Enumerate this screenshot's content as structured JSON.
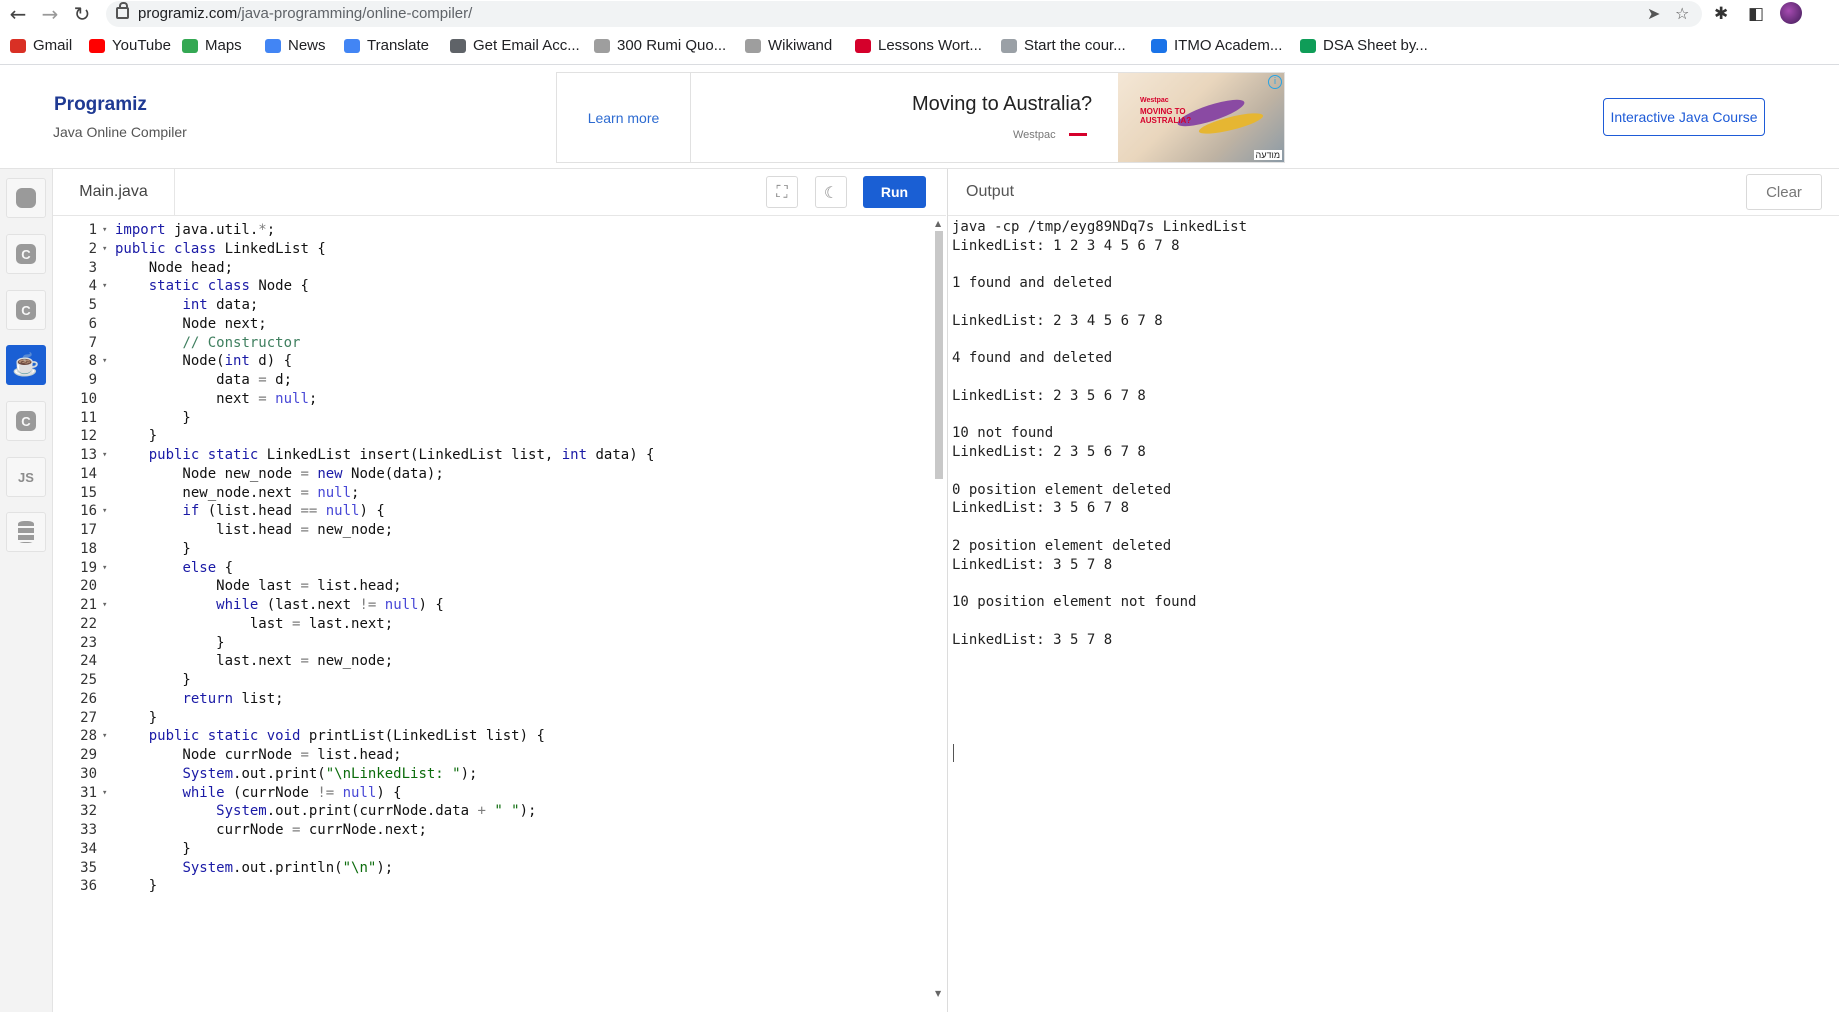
{
  "browser": {
    "url_host": "programiz.com",
    "url_path": "/java-programming/online-compiler/",
    "bookmarks": [
      {
        "label": "Gmail",
        "icon": "gmail-icon",
        "color": "#d93025"
      },
      {
        "label": "YouTube",
        "icon": "youtube-icon",
        "color": "#ff0000"
      },
      {
        "label": "Maps",
        "icon": "maps-icon",
        "color": "#34a853"
      },
      {
        "label": "News",
        "icon": "news-icon",
        "color": "#4285f4"
      },
      {
        "label": "Translate",
        "icon": "translate-icon",
        "color": "#4285f4"
      },
      {
        "label": "Get Email Acc...",
        "icon": "globe-icon",
        "color": "#5f6368"
      },
      {
        "label": "300 Rumi Quo...",
        "icon": "w-icon",
        "color": "#9e9e9e"
      },
      {
        "label": "Wikiwand",
        "icon": "wikiwand-icon",
        "color": "#9e9e9e"
      },
      {
        "label": "Lessons Wort...",
        "icon": "lessons-icon",
        "color": "#d5002b"
      },
      {
        "label": "Start the cour...",
        "icon": "course-icon",
        "color": "#9aa0a6"
      },
      {
        "label": "ITMO Academ...",
        "icon": "itmo-icon",
        "color": "#1a73e8"
      },
      {
        "label": "DSA Sheet by...",
        "icon": "sheets-icon",
        "color": "#0f9d58"
      }
    ]
  },
  "header": {
    "logo": "Programiz",
    "subtitle": "Java Online Compiler",
    "ad": {
      "learn_more": "Learn more",
      "headline": "Moving to Australia?",
      "brand": "Westpac",
      "image_brand": "Westpac",
      "image_text": "MOVING TO AUSTRALIA?",
      "image_label": "מודעה"
    },
    "course_button": "Interactive Java Course"
  },
  "sidebar": {
    "languages": [
      {
        "name": "python",
        "label": "",
        "icon": "python-icon"
      },
      {
        "name": "c",
        "label": "C",
        "icon": "c-icon"
      },
      {
        "name": "cpp",
        "label": "C",
        "icon": "cpp-icon"
      },
      {
        "name": "java",
        "label": "☕",
        "icon": "java-icon",
        "active": true
      },
      {
        "name": "csharp",
        "label": "C",
        "icon": "csharp-icon"
      },
      {
        "name": "js",
        "label": "JS",
        "icon": "js-icon"
      },
      {
        "name": "sql",
        "label": "",
        "icon": "database-icon"
      }
    ]
  },
  "editor": {
    "file_name": "Main.java",
    "run_label": "Run",
    "lines": [
      "import java.util.*;",
      "public class LinkedList {",
      "    Node head;",
      "    static class Node {",
      "        int data;",
      "        Node next;",
      "        // Constructor",
      "        Node(int d) {",
      "            data = d;",
      "            next = null;",
      "        }",
      "    }",
      "    public static LinkedList insert(LinkedList list, int data) {",
      "        Node new_node = new Node(data);",
      "        new_node.next = null;",
      "        if (list.head == null) {",
      "            list.head = new_node;",
      "        }",
      "        else {",
      "            Node last = list.head;",
      "            while (last.next != null) {",
      "                last = last.next;",
      "            }",
      "            last.next = new_node;",
      "        }",
      "        return list;",
      "    }",
      "    public static void printList(LinkedList list) {",
      "        Node currNode = list.head;",
      "        System.out.print(\"\\nLinkedList: \");",
      "        while (currNode != null) {",
      "            System.out.print(currNode.data + \" \");",
      "            currNode = currNode.next;",
      "        }",
      "        System.out.println(\"\\n\");",
      "    }"
    ],
    "fold_lines": [
      1,
      2,
      4,
      8,
      13,
      16,
      19,
      21,
      28,
      31
    ]
  },
  "output": {
    "title": "Output",
    "clear_label": "Clear",
    "lines": [
      "java -cp /tmp/eyg89NDq7s LinkedList",
      "LinkedList: 1 2 3 4 5 6 7 8",
      "",
      "1 found and deleted",
      "",
      "LinkedList: 2 3 4 5 6 7 8",
      "",
      "4 found and deleted",
      "",
      "LinkedList: 2 3 5 6 7 8",
      "",
      "10 not found",
      "LinkedList: 2 3 5 6 7 8",
      "",
      "0 position element deleted",
      "LinkedList: 3 5 6 7 8",
      "",
      "2 position element deleted",
      "LinkedList: 3 5 7 8",
      "",
      "10 position element not found",
      "",
      "LinkedList: 3 5 7 8"
    ]
  },
  "colors": {
    "accent": "#1a5fd4",
    "keyword": "#1a1aa6",
    "comment": "#3f7f5f",
    "string": "#0b6b0b"
  }
}
